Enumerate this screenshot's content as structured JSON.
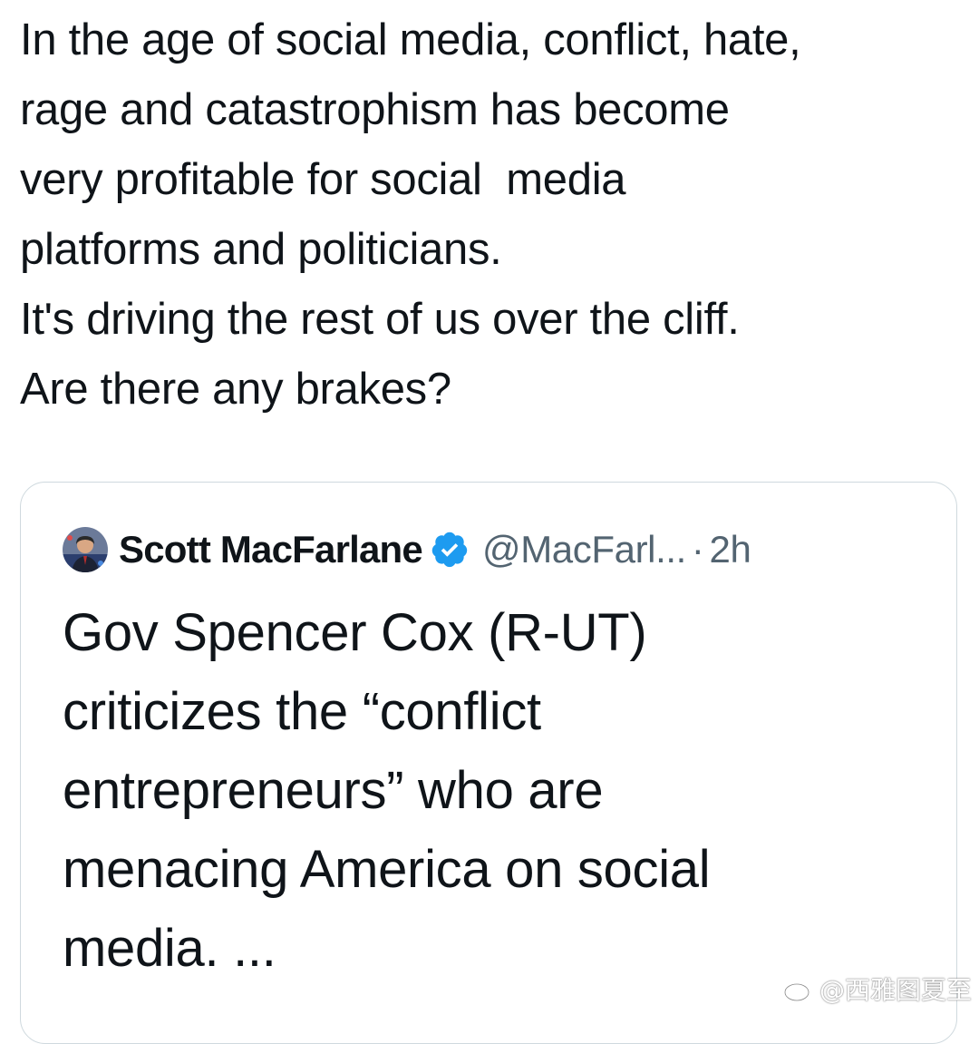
{
  "tweet": {
    "lines": [
      "In the age of social media, conflict, hate,",
      "rage and catastrophism has become",
      "very profitable for social  media",
      "platforms and politicians.",
      "It's driving the rest of us over the cliff.",
      "Are there any brakes?"
    ]
  },
  "quote": {
    "author_name": "Scott MacFarlane",
    "handle": "@MacFarl...",
    "separator": "·",
    "time": "2h",
    "verified_icon": "verified-badge-icon",
    "verified_color": "#1d9bf0",
    "lines": [
      "Gov Spencer Cox (R-UT)",
      "criticizes the “conflict",
      "entrepreneurs” who are",
      "menacing America on social",
      "media. ..."
    ]
  },
  "watermark": {
    "icon": "weibo-icon",
    "text": "@西雅图夏至"
  }
}
